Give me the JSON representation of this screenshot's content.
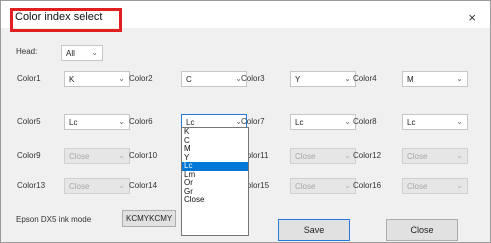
{
  "window": {
    "title": "Color index select",
    "close_glyph": "×"
  },
  "head": {
    "label": "Head:",
    "value": "All"
  },
  "colors": [
    {
      "label": "Color1",
      "value": "K",
      "disabled": false
    },
    {
      "label": "Color2",
      "value": "C",
      "disabled": false
    },
    {
      "label": "Color3",
      "value": "Y",
      "disabled": false
    },
    {
      "label": "Color4",
      "value": "M",
      "disabled": false
    },
    {
      "label": "Color5",
      "value": "Lc",
      "disabled": false
    },
    {
      "label": "Color6",
      "value": "Lc",
      "disabled": false
    },
    {
      "label": "Color7",
      "value": "Lc",
      "disabled": false
    },
    {
      "label": "Color8",
      "value": "Lc",
      "disabled": false
    },
    {
      "label": "Color9",
      "value": "Close",
      "disabled": true
    },
    {
      "label": "Color10",
      "value": "Close",
      "disabled": true
    },
    {
      "label": "Color11",
      "value": "Close",
      "disabled": true
    },
    {
      "label": "Color12",
      "value": "Close",
      "disabled": true
    },
    {
      "label": "Color13",
      "value": "Close",
      "disabled": true
    },
    {
      "label": "Color14",
      "value": "Close",
      "disabled": true
    },
    {
      "label": "Color15",
      "value": "Close",
      "disabled": true
    },
    {
      "label": "Color16",
      "value": "Close",
      "disabled": true
    }
  ],
  "dropdown": {
    "options": [
      "K",
      "C",
      "M",
      "Y",
      "Lc",
      "Lm",
      "Or",
      "Gr",
      "Close"
    ],
    "selected": "Lc"
  },
  "ink_mode": {
    "label": "Epson DX5 ink mode",
    "value": "KCMYKCMY"
  },
  "buttons": {
    "save": "Save",
    "close": "Close"
  },
  "icons": {
    "arrow": "chevron-down-icon",
    "close": "close-icon"
  },
  "colors_theme": {
    "highlight_box": "#e02020",
    "selection": "#0078d7",
    "focus": "#2b79d6"
  }
}
